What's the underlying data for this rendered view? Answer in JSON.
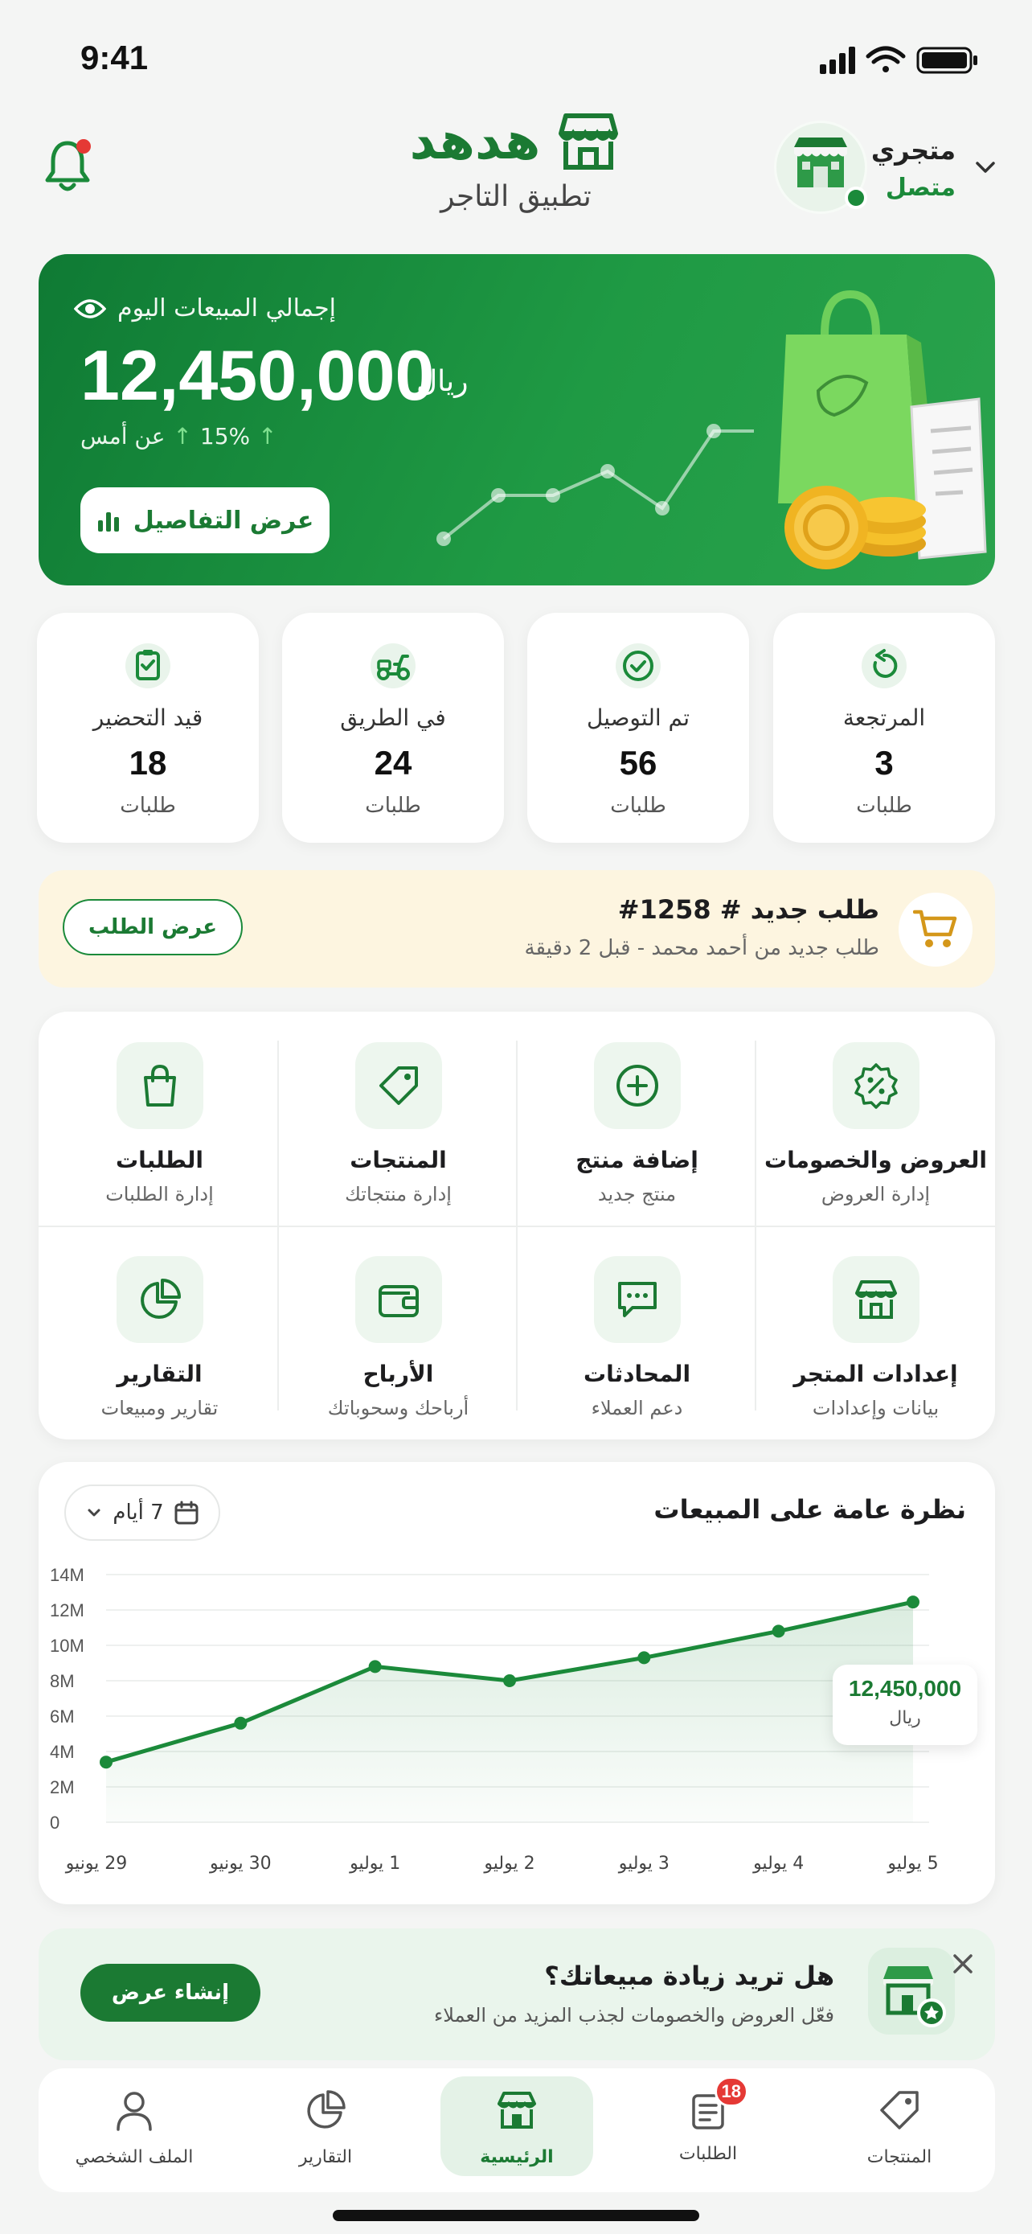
{
  "status_bar": {
    "time": "9:41"
  },
  "header": {
    "brand_name": "هدهد",
    "brand_subtitle": "تطبيق التاجر",
    "store_name": "متجري",
    "store_status": "متصل"
  },
  "hero": {
    "label": "إجمالي المبيعات اليوم",
    "amount": "12,450,000",
    "currency": "ريال",
    "change_value": "15%",
    "change_text": "عن أمس",
    "details_button": "عرض التفاصيل"
  },
  "order_stats": [
    {
      "label": "المرتجعة",
      "value": "3",
      "unit": "طلبات",
      "icon": "return-icon"
    },
    {
      "label": "تم التوصيل",
      "value": "56",
      "unit": "طلبات",
      "icon": "check-circle-icon"
    },
    {
      "label": "في الطريق",
      "value": "24",
      "unit": "طلبات",
      "icon": "scooter-icon"
    },
    {
      "label": "قيد التحضير",
      "value": "18",
      "unit": "طلبات",
      "icon": "prep-clipboard-icon"
    }
  ],
  "new_order": {
    "title": "طلب جديد # 1258#",
    "subtitle": "طلب جديد من أحمد محمد - قبل 2 دقيقة",
    "button": "عرض الطلب"
  },
  "quick_actions": [
    {
      "title": "العروض والخصومات",
      "subtitle": "إدارة العروض",
      "icon": "discount-badge-icon"
    },
    {
      "title": "إضافة منتج",
      "subtitle": "منتج جديد",
      "icon": "plus-circle-icon"
    },
    {
      "title": "المنتجات",
      "subtitle": "إدارة منتجاتك",
      "icon": "tag-icon"
    },
    {
      "title": "الطلبات",
      "subtitle": "إدارة الطلبات",
      "icon": "shopping-bag-icon"
    },
    {
      "title": "إعدادات المتجر",
      "subtitle": "بيانات وإعدادات",
      "icon": "storefront-icon"
    },
    {
      "title": "المحادثات",
      "subtitle": "دعم العملاء",
      "icon": "chat-icon"
    },
    {
      "title": "الأرباح",
      "subtitle": "أرباحك وسحوباتك",
      "icon": "wallet-icon"
    },
    {
      "title": "التقارير",
      "subtitle": "تقارير ومبيعات",
      "icon": "pie-chart-icon"
    }
  ],
  "sales_overview": {
    "title": "نظرة عامة على المبيعات",
    "range": "7 أيام",
    "tooltip_value": "12,450,000",
    "tooltip_currency": "ريال"
  },
  "chart_data": {
    "type": "area",
    "title": "نظرة عامة على المبيعات",
    "categories": [
      "29 يونيو",
      "30 يونيو",
      "1 يوليو",
      "2 يوليو",
      "3 يوليو",
      "4 يوليو",
      "5 يوليو"
    ],
    "values": [
      3.4,
      5.6,
      8.8,
      8.0,
      9.3,
      10.8,
      12.45
    ],
    "y_unit": "M",
    "y_ticks": [
      "0",
      "2M",
      "4M",
      "6M",
      "8M",
      "10M",
      "12M",
      "14M"
    ],
    "ylim": [
      0,
      14
    ],
    "grid": true,
    "color": "#1b8a3a"
  },
  "promo": {
    "title": "هل تريد زيادة مبيعاتك؟",
    "subtitle": "فعّل العروض والخصومات لجذب المزيد من العملاء",
    "button": "إنشاء عرض"
  },
  "tab_bar": [
    {
      "label": "المنتجات",
      "icon": "tag-icon"
    },
    {
      "label": "الطلبات",
      "icon": "orders-icon",
      "badge": "18"
    },
    {
      "label": "الرئيسية",
      "icon": "home-store-icon",
      "active": true
    },
    {
      "label": "التقارير",
      "icon": "pie-chart-icon"
    },
    {
      "label": "الملف الشخصي",
      "icon": "user-icon"
    }
  ],
  "colors": {
    "brand_green": "#1b7a33",
    "accent_green": "#1b8a3a",
    "banner_cream": "#fdf5e0",
    "badge_red": "#e53935"
  }
}
